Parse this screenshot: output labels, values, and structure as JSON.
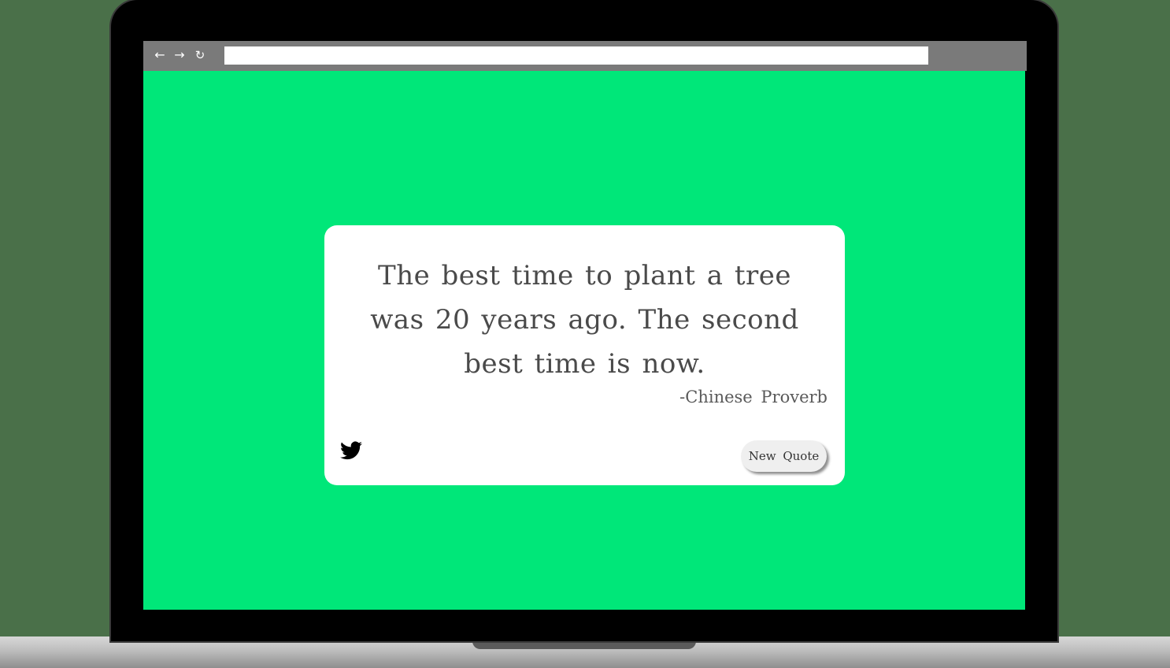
{
  "browser": {
    "nav": {
      "back_icon": "arrow-left-icon",
      "forward_icon": "arrow-right-icon",
      "reload_icon": "reload-icon"
    },
    "url_value": ""
  },
  "quote_card": {
    "quote": "The best time to plant a tree was 20 years ago. The second best time is now.",
    "author": "-Chinese Proverb",
    "share_icon": "twitter-icon",
    "new_quote_label": "New Quote"
  },
  "colors": {
    "page_background": "#00e779",
    "card_background": "#ffffff",
    "browser_bar": "#7a7a7a",
    "text": "#4a4a4a"
  }
}
